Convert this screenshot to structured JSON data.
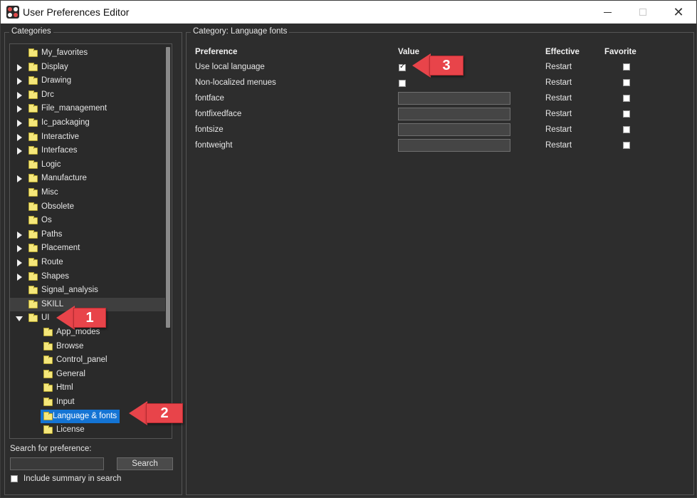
{
  "window": {
    "title": "User Preferences Editor"
  },
  "categories": {
    "legend": "Categories",
    "items": [
      {
        "label": "My_favorites",
        "arrow": "none",
        "level": 0
      },
      {
        "label": "Display",
        "arrow": "right",
        "level": 0
      },
      {
        "label": "Drawing",
        "arrow": "right",
        "level": 0
      },
      {
        "label": "Drc",
        "arrow": "right",
        "level": 0
      },
      {
        "label": "File_management",
        "arrow": "right",
        "level": 0
      },
      {
        "label": "Ic_packaging",
        "arrow": "right",
        "level": 0
      },
      {
        "label": "Interactive",
        "arrow": "right",
        "level": 0
      },
      {
        "label": "Interfaces",
        "arrow": "right",
        "level": 0
      },
      {
        "label": "Logic",
        "arrow": "none",
        "level": 0
      },
      {
        "label": "Manufacture",
        "arrow": "right",
        "level": 0
      },
      {
        "label": "Misc",
        "arrow": "none",
        "level": 0
      },
      {
        "label": "Obsolete",
        "arrow": "none",
        "level": 0
      },
      {
        "label": "Os",
        "arrow": "none",
        "level": 0
      },
      {
        "label": "Paths",
        "arrow": "right",
        "level": 0
      },
      {
        "label": "Placement",
        "arrow": "right",
        "level": 0
      },
      {
        "label": "Route",
        "arrow": "right",
        "level": 0
      },
      {
        "label": "Shapes",
        "arrow": "right",
        "level": 0
      },
      {
        "label": "Signal_analysis",
        "arrow": "none",
        "level": 0
      },
      {
        "label": "SKILL",
        "arrow": "none",
        "level": 0,
        "highlighted": true
      },
      {
        "label": "UI",
        "arrow": "down",
        "level": 0
      },
      {
        "label": "App_modes",
        "arrow": "none",
        "level": 1
      },
      {
        "label": "Browse",
        "arrow": "none",
        "level": 1
      },
      {
        "label": "Control_panel",
        "arrow": "none",
        "level": 1
      },
      {
        "label": "General",
        "arrow": "none",
        "level": 1
      },
      {
        "label": "Html",
        "arrow": "none",
        "level": 1
      },
      {
        "label": "Input",
        "arrow": "none",
        "level": 1
      },
      {
        "label": "Language & fonts",
        "arrow": "none",
        "level": 1,
        "selected": true
      },
      {
        "label": "License",
        "arrow": "none",
        "level": 1
      }
    ]
  },
  "search": {
    "label": "Search for preference:",
    "value": "",
    "button": "Search",
    "include_summary_label": "Include summary in search",
    "include_summary_checked": false
  },
  "preferences": {
    "legend": "Category:  Language  fonts",
    "headers": {
      "preference": "Preference",
      "value": "Value",
      "effective": "Effective",
      "favorite": "Favorite"
    },
    "rows": [
      {
        "name": "Use local language",
        "type": "checkbox",
        "checked": true,
        "effective": "Restart",
        "favorite": false
      },
      {
        "name": "Non-localized menues",
        "type": "checkbox",
        "checked": false,
        "effective": "Restart",
        "favorite": false
      },
      {
        "name": "fontface",
        "type": "text",
        "value": "",
        "effective": "Restart",
        "favorite": false
      },
      {
        "name": "fontfixedface",
        "type": "text",
        "value": "",
        "effective": "Restart",
        "favorite": false
      },
      {
        "name": "fontsize",
        "type": "text",
        "value": "",
        "effective": "Restart",
        "favorite": false
      },
      {
        "name": "fontweight",
        "type": "text",
        "value": "",
        "effective": "Restart",
        "favorite": false
      }
    ]
  },
  "callouts": [
    {
      "label": "1"
    },
    {
      "label": "2"
    },
    {
      "label": "3"
    }
  ],
  "colors": {
    "callout": "#e8444a",
    "selection": "#1474d4",
    "folder": "#f5e77a",
    "background": "#2d2d2d"
  }
}
